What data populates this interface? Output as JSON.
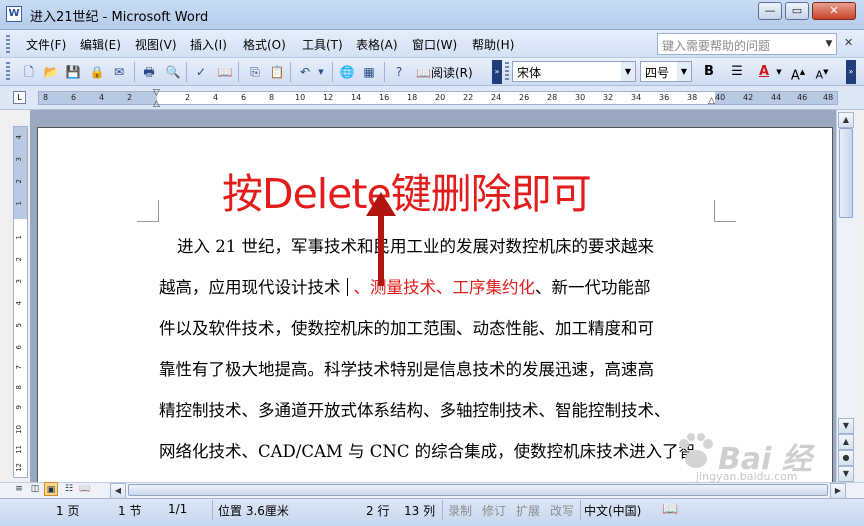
{
  "window": {
    "title": "进入21世纪 - Microsoft Word",
    "app_icon": "W"
  },
  "menu": {
    "items": [
      "文件(F)",
      "编辑(E)",
      "视图(V)",
      "插入(I)",
      "格式(O)",
      "工具(T)",
      "表格(A)",
      "窗口(W)",
      "帮助(H)"
    ],
    "help_placeholder": "键入需要帮助的问题"
  },
  "toolbar": {
    "read_label": "阅读(R)",
    "font_name": "宋体",
    "font_size": "四号",
    "bold_label": "B",
    "font_color_label": "A"
  },
  "ruler": {
    "labels": [
      "8",
      "6",
      "4",
      "2",
      "2",
      "4",
      "6",
      "8",
      "10",
      "12",
      "14",
      "16",
      "18",
      "20",
      "22",
      "24",
      "26",
      "28",
      "30",
      "32",
      "34",
      "36",
      "38",
      "40",
      "42",
      "44",
      "46",
      "48"
    ],
    "vlabels": [
      "4",
      "3",
      "2",
      "1",
      "1",
      "2",
      "3",
      "4",
      "5",
      "6",
      "7",
      "8",
      "9",
      "10",
      "11",
      "12"
    ]
  },
  "annotation": {
    "text": "按Delete键删除即可",
    "color": "#e21b1b"
  },
  "document": {
    "line1": "进入 21 世纪，军事技术和民用工业的发展对数控机床的要求越来",
    "line2_pre": "越高，应用现代设计技术",
    "line2_red": "、测量技术、工序集约化",
    "line2_post": "、新一代功能部",
    "line3": "件以及软件技术，使数控机床的加工范围、动态性能、加工精度和可",
    "line4": "靠性有了极大地提高。科学技术特别是信息技术的发展迅速，高速高",
    "line5": "精控制技术、多通道开放式体系结构、多轴控制技术、智能控制技术、",
    "line6": "网络化技术、CAD/CAM 与 CNC 的综合集成，使数控机床技术进入了智"
  },
  "watermark": {
    "text": "Bai 经验",
    "url": "jingyan.baidu.com"
  },
  "status": {
    "page": "1 页",
    "section": "1 节",
    "page_of": "1/1",
    "position": "位置 3.6厘米",
    "line": "2 行",
    "column": "13 列",
    "rec": "录制",
    "trk": "修订",
    "ext": "扩展",
    "ovr": "改写",
    "language": "中文(中国)"
  }
}
